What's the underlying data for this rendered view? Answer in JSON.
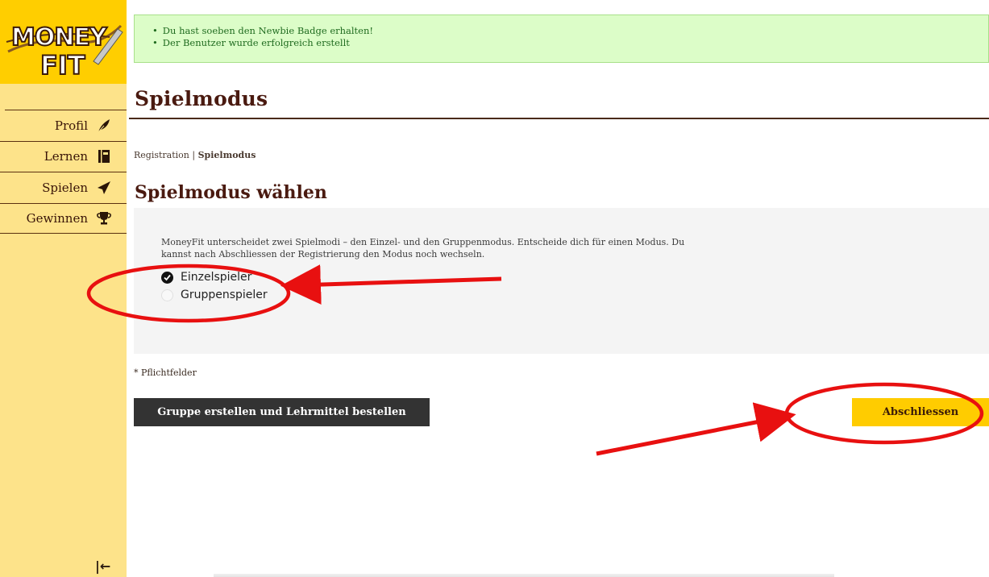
{
  "app": {
    "logo_text_top": "MONEY",
    "logo_text_bottom": "FIT"
  },
  "sidebar": {
    "items": [
      {
        "label": "Profil",
        "icon": "feather-icon"
      },
      {
        "label": "Lernen",
        "icon": "book-icon"
      },
      {
        "label": "Spielen",
        "icon": "paper-plane-icon"
      },
      {
        "label": "Gewinnen",
        "icon": "trophy-icon"
      }
    ],
    "collapse_icon": "|←"
  },
  "alert": {
    "messages": [
      "Du hast soeben den Newbie Badge erhalten!",
      "Der Benutzer wurde erfolgreich erstellt"
    ]
  },
  "page": {
    "title": "Spielmodus",
    "breadcrumb": {
      "parent": "Registration",
      "separator": " | ",
      "current": "Spielmodus"
    },
    "section_title": "Spielmodus wählen",
    "description": "MoneyFit unterscheidet zwei Spielmodi – den Einzel- und den Gruppenmodus. Entscheide dich für einen Modus. Du kannst nach Abschliessen der Registrierung den Modus noch wechseln.",
    "options": [
      {
        "label": "Einzelspieler",
        "selected": true
      },
      {
        "label": "Gruppenspieler",
        "selected": false
      }
    ],
    "required_note": "* Pflichtfelder",
    "create_group_button": "Gruppe erstellen und Lehrmittel bestellen",
    "finish_button": "Abschliessen"
  },
  "colors": {
    "sidebar_bg": "#fde38a",
    "logo_bg": "#ffce00",
    "accent_yellow": "#ffcc00",
    "dark_button": "#333333",
    "alert_bg": "#dcfdc8",
    "annotation_red": "#e81010"
  }
}
